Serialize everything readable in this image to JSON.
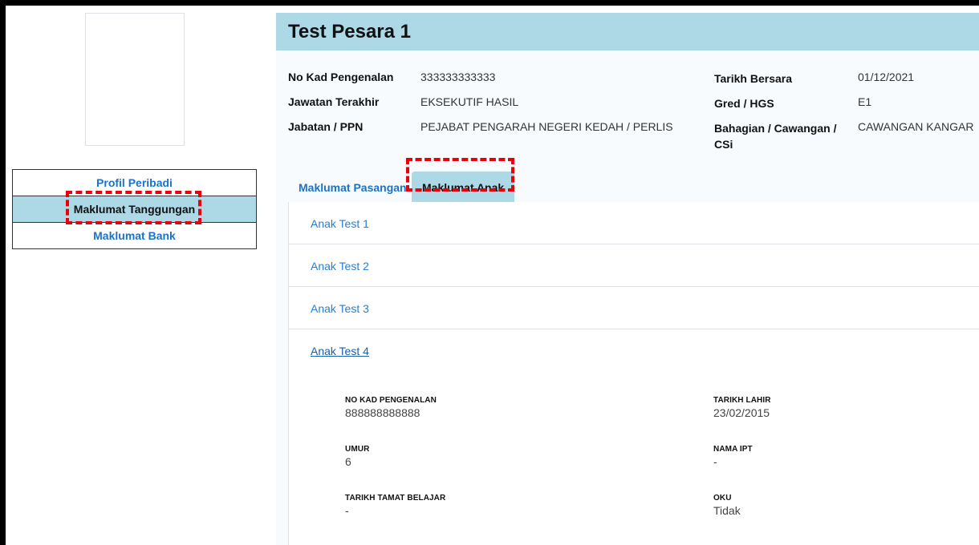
{
  "profile": {
    "name": "Test Pesara 1",
    "fields": [
      {
        "label": "No Kad Pengenalan",
        "value": "333333333333"
      },
      {
        "label": "Tarikh Bersara",
        "value": "01/12/2021"
      },
      {
        "label": "Jawatan Terakhir",
        "value": "EKSEKUTIF HASIL"
      },
      {
        "label": "Gred / HGS",
        "value": "E1"
      },
      {
        "label": "Jabatan / PPN",
        "value": "PEJABAT PENGARAH NEGERI KEDAH / PERLIS"
      },
      {
        "label": "Bahagian / Cawangan / CSi",
        "value": "CAWANGAN KANGAR"
      }
    ]
  },
  "sidebar": {
    "items": [
      {
        "label": "Profil Peribadi",
        "active": false
      },
      {
        "label": "Maklumat Tanggungan",
        "active": true
      },
      {
        "label": "Maklumat Bank",
        "active": false
      }
    ]
  },
  "tabs": [
    {
      "label": "Maklumat Pasangan",
      "active": false
    },
    {
      "label": "Maklumat Anak",
      "active": true
    }
  ],
  "children": [
    {
      "name": "Anak Test 1",
      "expanded": false
    },
    {
      "name": "Anak Test 2",
      "expanded": false
    },
    {
      "name": "Anak Test 3",
      "expanded": false
    },
    {
      "name": "Anak Test 4",
      "expanded": true
    }
  ],
  "child_detail": {
    "fields": [
      {
        "label": "NO KAD PENGENALAN",
        "value": "888888888888"
      },
      {
        "label": "TARIKH LAHIR",
        "value": "23/02/2015"
      },
      {
        "label": "UMUR",
        "value": "6"
      },
      {
        "label": "NAMA IPT",
        "value": "-"
      },
      {
        "label": "TARIKH TAMAT BELAJAR",
        "value": "-"
      },
      {
        "label": "OKU",
        "value": "Tidak"
      }
    ]
  },
  "colors": {
    "accent": "#add8e6",
    "link": "#1a73c8",
    "highlight": "#e8000b"
  }
}
